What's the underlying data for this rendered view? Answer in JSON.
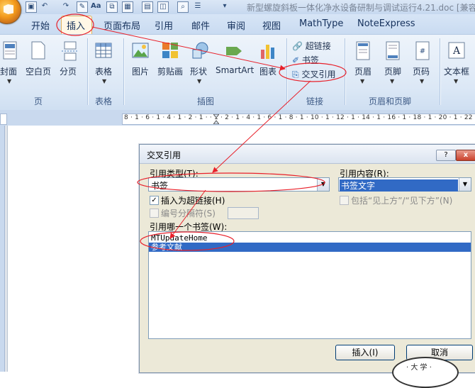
{
  "window": {
    "title": "新型螺旋斜板一体化净水设备研制与调试运行4.21.doc [兼容"
  },
  "quick_access": {
    "icons": [
      "save-icon",
      "undo-icon",
      "redo-icon",
      "new-doc-icon",
      "font-icon",
      "copy-icon",
      "table-icon",
      "layout-icon",
      "print-preview-icon",
      "list-icon",
      "customize-icon"
    ]
  },
  "ribbon_tabs": [
    {
      "label": "开始"
    },
    {
      "label": "插入"
    },
    {
      "label": "页面布局"
    },
    {
      "label": "引用"
    },
    {
      "label": "邮件"
    },
    {
      "label": "审阅"
    },
    {
      "label": "视图"
    },
    {
      "label": "MathType"
    },
    {
      "label": "NoteExpress"
    }
  ],
  "ribbon": {
    "groups": {
      "pages": "页",
      "tables": "表格",
      "illustrations": "插图",
      "links": "链接",
      "header_footer": "页眉和页脚"
    },
    "buttons": {
      "cover": "封面",
      "blank_page": "空白页",
      "page_break": "分页",
      "table": "表格",
      "picture": "图片",
      "clipart": "剪贴画",
      "shapes": "形状",
      "smartart": "SmartArt",
      "chart": "图表",
      "hyperlink": "超链接",
      "bookmark": "书签",
      "cross_ref": "交叉引用",
      "header": "页眉",
      "footer": "页脚",
      "page_number": "页码",
      "textbox": "文本框"
    }
  },
  "ruler": {
    "text": "8 · 1 · 6 · 1 · 4 · 1 · 2 · 1 ·   · 1 · 2 · 1 · 4 · 1 · 6 · 1 · 8 · 1 · 10 · 1 · 12 · 1 · 14 · 1 · 16 · 1 · 18 · 1 · 20 · 1 · 22"
  },
  "dialog": {
    "title": "交叉引用",
    "help_button": "?",
    "close_button": "x",
    "ref_type_label": "引用类型(T):",
    "ref_type_value": "书签",
    "ref_content_label": "引用内容(R):",
    "ref_content_value": "书签文字",
    "insert_as_hyperlink_label": "插入为超链接(H)",
    "insert_as_hyperlink_checked": "✓",
    "include_above_below_label": "包括“见上方”/“见下方”(N)",
    "number_separator_label": "编号分隔符(S)",
    "which_bookmark_label": "引用哪一个书签(W):",
    "bookmarks": [
      {
        "label": "MTUpdateHome"
      },
      {
        "label": "参考文献"
      }
    ],
    "insert_button": "插入(I)",
    "cancel_button": "取消"
  },
  "annotation_color": "#e8202a",
  "selection_color": "#316ac5",
  "seal": {
    "text": "· 大 学 ·"
  }
}
